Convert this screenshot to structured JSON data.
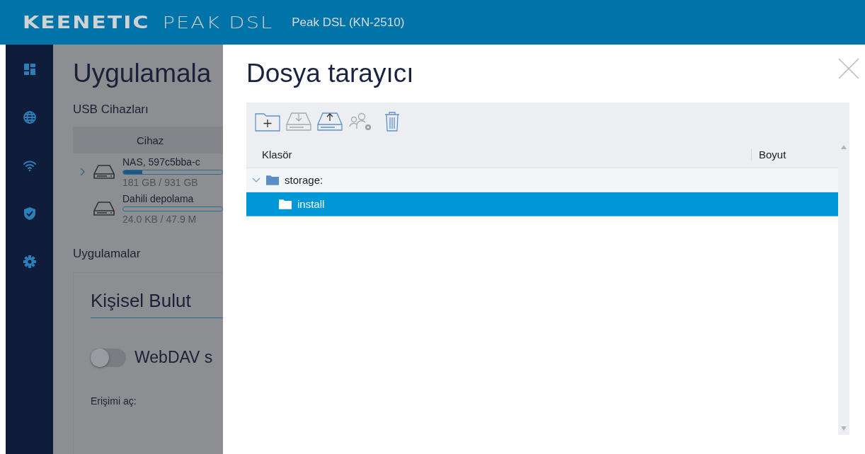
{
  "header": {
    "logo": "KEENETIC",
    "product": "PEAK DSL",
    "model": "Peak DSL (KN-2510)"
  },
  "background_page": {
    "title": "Uygulamala",
    "usb_section": "USB Cihazları",
    "device_column": "Cihaz",
    "devices": [
      {
        "name": "NAS, 597c5bba-c",
        "usage": "181 GB / 931 GB",
        "level": 0.19,
        "expandable": true
      },
      {
        "name": "Dahili depolama",
        "usage": "24.0 KB / 47.9 M",
        "level": 0.0,
        "expandable": false
      }
    ],
    "apps_section": "Uygulamalar",
    "card_title": "Kişisel Bulut",
    "toggle": {
      "label": "WebDAV s",
      "on": false
    },
    "access_label": "Erişimi aç:"
  },
  "dialog": {
    "title": "Dosya tarayıcı",
    "toolbar": [
      {
        "kind": "new-folder",
        "disabled": false
      },
      {
        "kind": "download",
        "disabled": true
      },
      {
        "kind": "upload",
        "disabled": false
      },
      {
        "kind": "permissions",
        "disabled": true
      },
      {
        "kind": "delete",
        "disabled": false
      }
    ],
    "columns": [
      "Klasör",
      "Boyut"
    ],
    "tree": [
      {
        "name": "storage:",
        "expanded": true,
        "selected": false,
        "children": [
          {
            "name": "install",
            "selected": true
          }
        ]
      }
    ]
  }
}
